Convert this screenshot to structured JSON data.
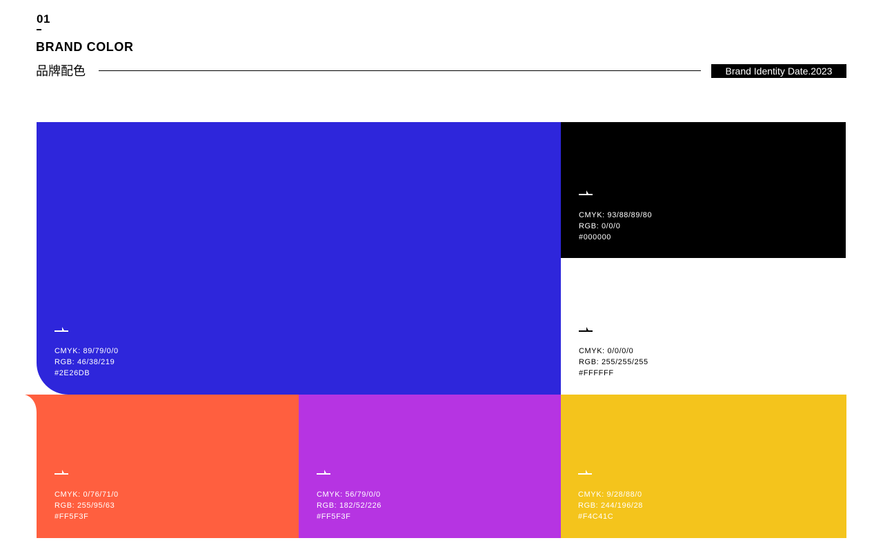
{
  "header": {
    "number": "01",
    "title_en": "BRAND COLOR",
    "title_cn": "品牌配色",
    "tag": "Brand Identity Date.2023"
  },
  "swatches": [
    {
      "id": "blue",
      "color": "#2E26DB",
      "text_color": "#ffffff",
      "cmyk": "CMYK: 89/79/0/0",
      "rgb": "RGB: 46/38/219",
      "hex": "#2E26DB"
    },
    {
      "id": "black",
      "color": "#000000",
      "text_color": "#ffffff",
      "cmyk": "CMYK: 93/88/89/80",
      "rgb": "RGB: 0/0/0",
      "hex": "#000000"
    },
    {
      "id": "white",
      "color": "#FFFFFF",
      "text_color": "#000000",
      "cmyk": "CMYK: 0/0/0/0",
      "rgb": "RGB: 255/255/255",
      "hex": "#FFFFFF"
    },
    {
      "id": "orange",
      "color": "#FF5F3F",
      "text_color": "#ffffff",
      "cmyk": "CMYK: 0/76/71/0",
      "rgb": "RGB: 255/95/63",
      "hex": "#FF5F3F"
    },
    {
      "id": "purple",
      "color": "#B634E2",
      "text_color": "#ffffff",
      "cmyk": "CMYK: 56/79/0/0",
      "rgb": "RGB: 182/52/226",
      "hex": "#FF5F3F"
    },
    {
      "id": "yellow",
      "color": "#F4C41C",
      "text_color": "#ffffff",
      "cmyk": "CMYK: 9/28/88/0",
      "rgb": "RGB: 244/196/28",
      "hex": "#F4C41C"
    }
  ]
}
